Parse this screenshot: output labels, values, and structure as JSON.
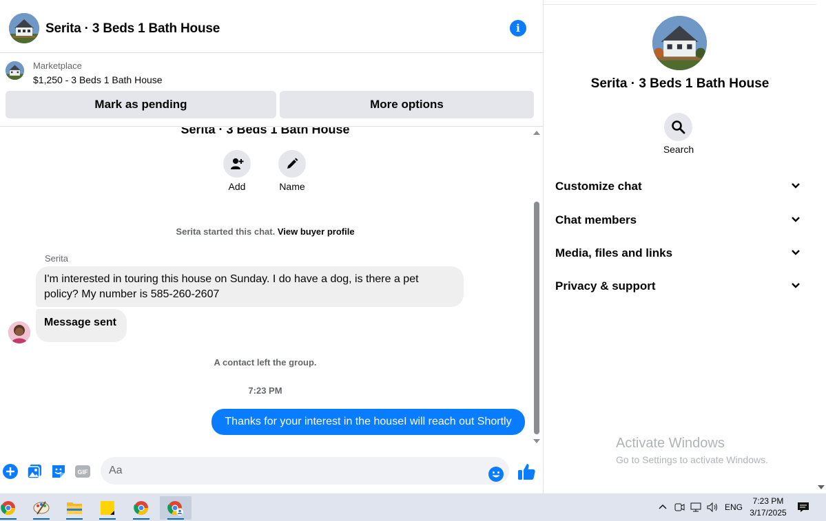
{
  "chat": {
    "title": "Serita · 3 Beds 1 Bath House",
    "info_icon": "info-icon"
  },
  "listing": {
    "source": "Marketplace",
    "price_title": "$1,250 - 3 Beds 1 Bath House",
    "mark_pending_label": "Mark as pending",
    "more_options_label": "More options"
  },
  "thread": {
    "header_title": "Serita · 3 Beds 1 Bath House",
    "add_label": "Add",
    "name_label": "Name",
    "started_text": "Serita started this chat. ",
    "view_profile_link": "View buyer profile",
    "sender_name": "Serita",
    "message_1": "I'm interested in touring this house on Sunday. I do have a dog, is there a pet policy? My number is 585-260-2607",
    "message_2": "Message sent",
    "contact_left": "A contact left the group.",
    "timestamp": "7:23 PM",
    "outgoing_message": "Thanks for your interest in the houseI will reach out Shortly"
  },
  "composer": {
    "placeholder": "Aa"
  },
  "info_panel": {
    "title": "Serita · 3 Beds 1 Bath House",
    "search_label": "Search",
    "sections": [
      {
        "label": "Customize chat"
      },
      {
        "label": "Chat members"
      },
      {
        "label": "Media, files and links"
      },
      {
        "label": "Privacy & support"
      }
    ]
  },
  "watermark": {
    "line1": "Activate Windows",
    "line2": "Go to Settings to activate Windows."
  },
  "taskbar": {
    "language": "ENG",
    "time": "7:23 PM",
    "date": "3/17/2025"
  },
  "colors": {
    "accent": "#0a7cff",
    "bubble_in": "#efefef",
    "button_bg": "#e4e6eb"
  }
}
